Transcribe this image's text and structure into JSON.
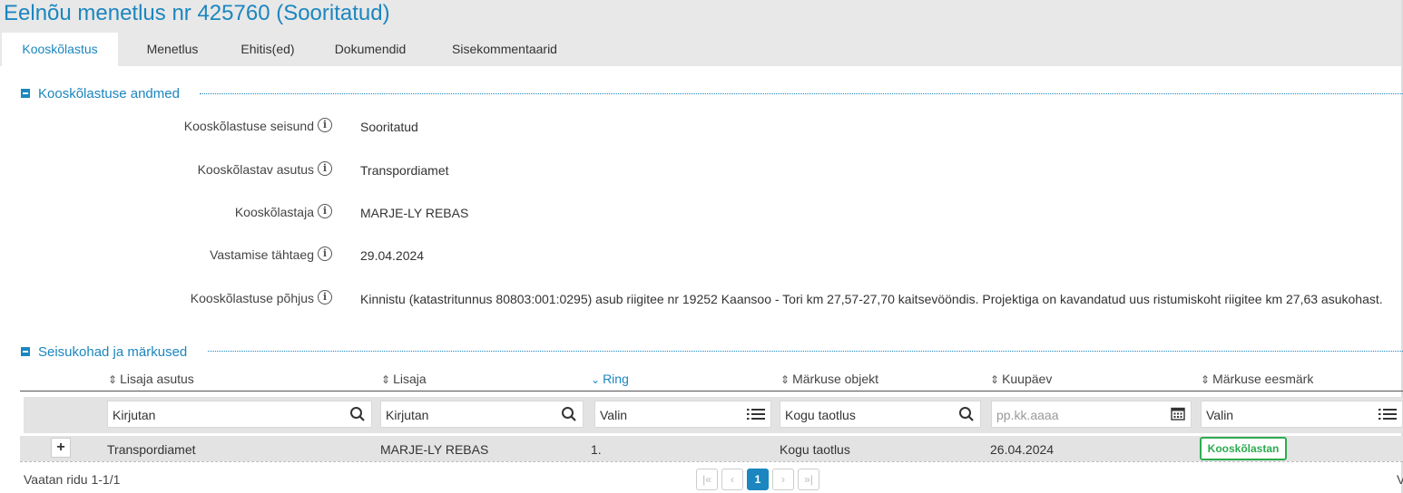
{
  "header": {
    "title": "Eelnõu menetlus nr 425760 (Sooritatud)",
    "tabs": [
      {
        "label": "Kooskõlastus",
        "active": true
      },
      {
        "label": "Menetlus",
        "active": false
      },
      {
        "label": "Ehitis(ed)",
        "active": false
      },
      {
        "label": "Dokumendid",
        "active": false
      },
      {
        "label": "Sisekommentaarid",
        "active": false
      }
    ]
  },
  "section1": {
    "title": "Kooskõlastuse andmed",
    "rows": [
      {
        "label": "Kooskõlastuse seisund",
        "value": "Sooritatud"
      },
      {
        "label": "Kooskõlastav asutus",
        "value": "Transpordiamet"
      },
      {
        "label": "Kooskõlastaja",
        "value": "MARJE-LY REBAS"
      },
      {
        "label": "Vastamise tähtaeg",
        "value": "29.04.2024"
      },
      {
        "label": "Kooskõlastuse põhjus",
        "value": "Kinnistu (katastritunnus 80803:001:0295) asub riigitee nr 19252 Kaansoo - Tori km 27,57-27,70 kaitsevööndis. Projektiga on kavandatud uus ristumiskoht riigitee km 27,63 asukohast."
      }
    ]
  },
  "section2": {
    "title": "Seisukohad ja märkused",
    "columns": [
      {
        "label": "Lisaja asutus",
        "sorted": false
      },
      {
        "label": "Lisaja",
        "sorted": false
      },
      {
        "label": "Ring",
        "sorted": true
      },
      {
        "label": "Märkuse objekt",
        "sorted": false
      },
      {
        "label": "Kuupäev",
        "sorted": false
      },
      {
        "label": "Märkuse eesmärk",
        "sorted": false
      }
    ],
    "filters": [
      {
        "text": "Kirjutan",
        "is_placeholder": false,
        "icon": "search-icon"
      },
      {
        "text": "Kirjutan",
        "is_placeholder": false,
        "icon": "search-icon"
      },
      {
        "text": "Valin",
        "is_placeholder": false,
        "icon": "list-icon"
      },
      {
        "text": "Kogu taotlus",
        "is_placeholder": false,
        "icon": "search-icon"
      },
      {
        "text": "pp.kk.aaaa",
        "is_placeholder": true,
        "icon": "calendar-icon"
      },
      {
        "text": "Valin",
        "is_placeholder": false,
        "icon": "list-icon"
      }
    ],
    "rows": [
      {
        "lisaja_asutus": "Transpordiamet",
        "lisaja": "MARJE-LY REBAS",
        "ring": "1.",
        "markuse_objekt": "Kogu taotlus",
        "kuupaev": "26.04.2024",
        "markuse_eesmark": "Kooskõlastan"
      }
    ]
  },
  "footer": {
    "info": "Vaatan ridu 1-1/1",
    "current_page": "1",
    "first_label": "|«",
    "prev_label": "‹",
    "next_label": "›",
    "last_label": "»|",
    "right_text": "V"
  },
  "colors": {
    "accent": "#1b86bf",
    "success": "#2dab4f"
  }
}
